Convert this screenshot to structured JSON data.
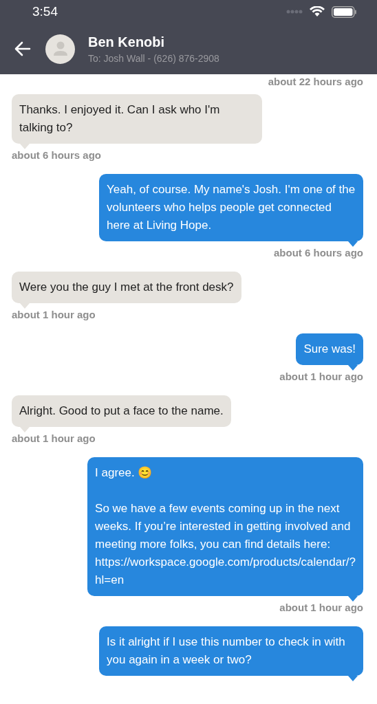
{
  "status_bar": {
    "time": "3:54"
  },
  "header": {
    "name": "Ben Kenobi",
    "subtitle": "To: Josh Wall - (626) 876-2908"
  },
  "top_time": "about 22 hours ago",
  "messages": [
    {
      "kind": "incoming",
      "text": "Thanks. I enjoyed it. Can I ask who I'm talking to?",
      "time": "about 6 hours ago"
    },
    {
      "kind": "outgoing",
      "text": "Yeah, of course. My name's Josh. I'm one of the volunteers who helps people get connected here at Living Hope.",
      "time": "about 6 hours ago"
    },
    {
      "kind": "incoming",
      "text": "Were you the guy I met at the front desk?",
      "time": "about 1 hour ago"
    },
    {
      "kind": "outgoing",
      "text": "Sure was!",
      "time": "about 1 hour ago"
    },
    {
      "kind": "incoming",
      "text": "Alright. Good to put a face to the name.",
      "time": "about 1 hour ago"
    },
    {
      "kind": "outgoing",
      "text": "I agree. 😊\n\nSo we have a few events coming up in the next weeks. If you’re interested in getting involved and meeting more folks, you can find details here: https://workspace.google.com/products/calendar/?hl=en",
      "time": "about 1 hour ago"
    },
    {
      "kind": "outgoing",
      "text": "Is it alright if I use this number to check in with you again in a week or two?"
    }
  ]
}
